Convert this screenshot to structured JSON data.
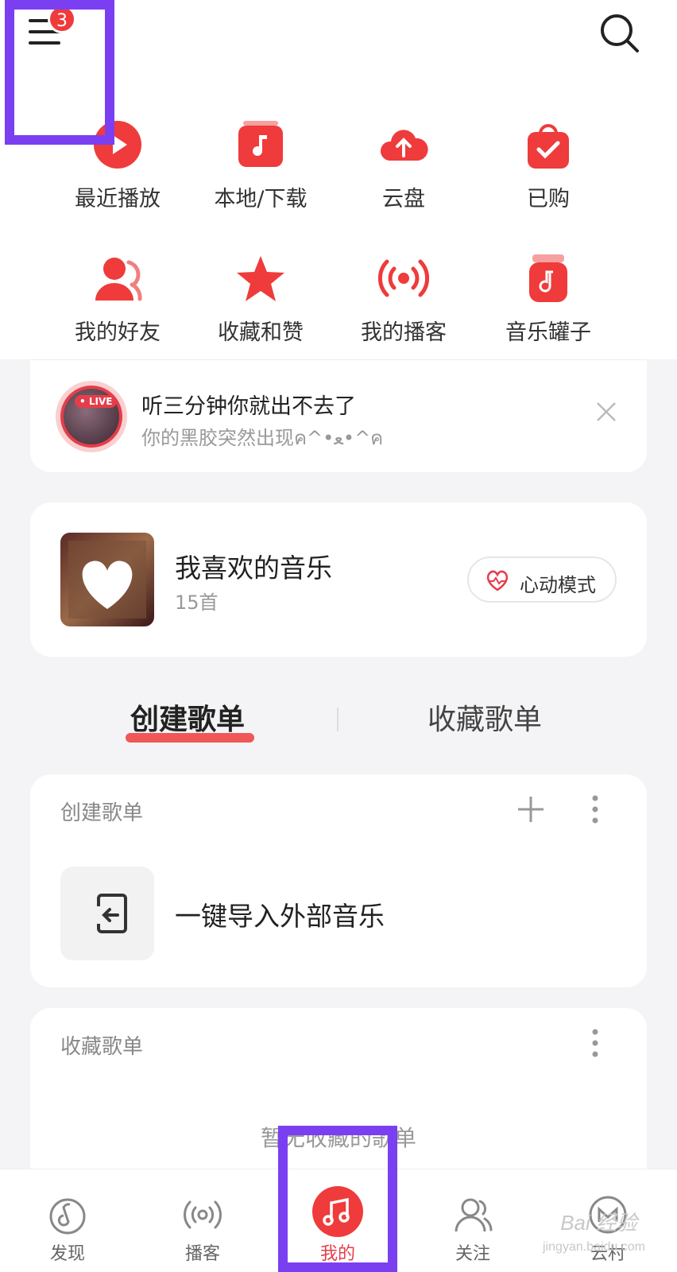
{
  "header": {
    "notification_count": "3"
  },
  "quick_actions": [
    {
      "label": "最近播放",
      "icon": "play-circle-icon"
    },
    {
      "label": "本地/下载",
      "icon": "music-box-icon"
    },
    {
      "label": "云盘",
      "icon": "cloud-upload-icon"
    },
    {
      "label": "已购",
      "icon": "shopping-bag-icon"
    },
    {
      "label": "我的好友",
      "icon": "friends-icon"
    },
    {
      "label": "收藏和赞",
      "icon": "star-icon"
    },
    {
      "label": "我的播客",
      "icon": "broadcast-icon"
    },
    {
      "label": "音乐罐子",
      "icon": "music-jar-icon"
    }
  ],
  "live_banner": {
    "tag": "• LIVE",
    "title": "听三分钟你就出不去了",
    "subtitle": "你的黑胶突然出现ค^•ﻌ•^ค"
  },
  "favorite": {
    "title": "我喜欢的音乐",
    "count": "15首",
    "heart_mode_label": "心动模式"
  },
  "tabs": {
    "active": "创建歌单",
    "other": "收藏歌单"
  },
  "created_section": {
    "title": "创建歌单",
    "import_label": "一键导入外部音乐"
  },
  "collected_section": {
    "title": "收藏歌单",
    "empty_text": "暂无收藏的歌单"
  },
  "bottom_nav": [
    {
      "label": "发现",
      "icon": "discover-icon"
    },
    {
      "label": "播客",
      "icon": "podcast-icon"
    },
    {
      "label": "我的",
      "icon": "music-note-icon"
    },
    {
      "label": "关注",
      "icon": "follow-icon"
    },
    {
      "label": "云村",
      "icon": "cloud-village-icon"
    }
  ],
  "watermark": {
    "brand": "Bai 经验",
    "url": "jingyan.baidu.com"
  },
  "colors": {
    "accent": "#ef3b3b",
    "highlight": "#7b3ff2"
  }
}
